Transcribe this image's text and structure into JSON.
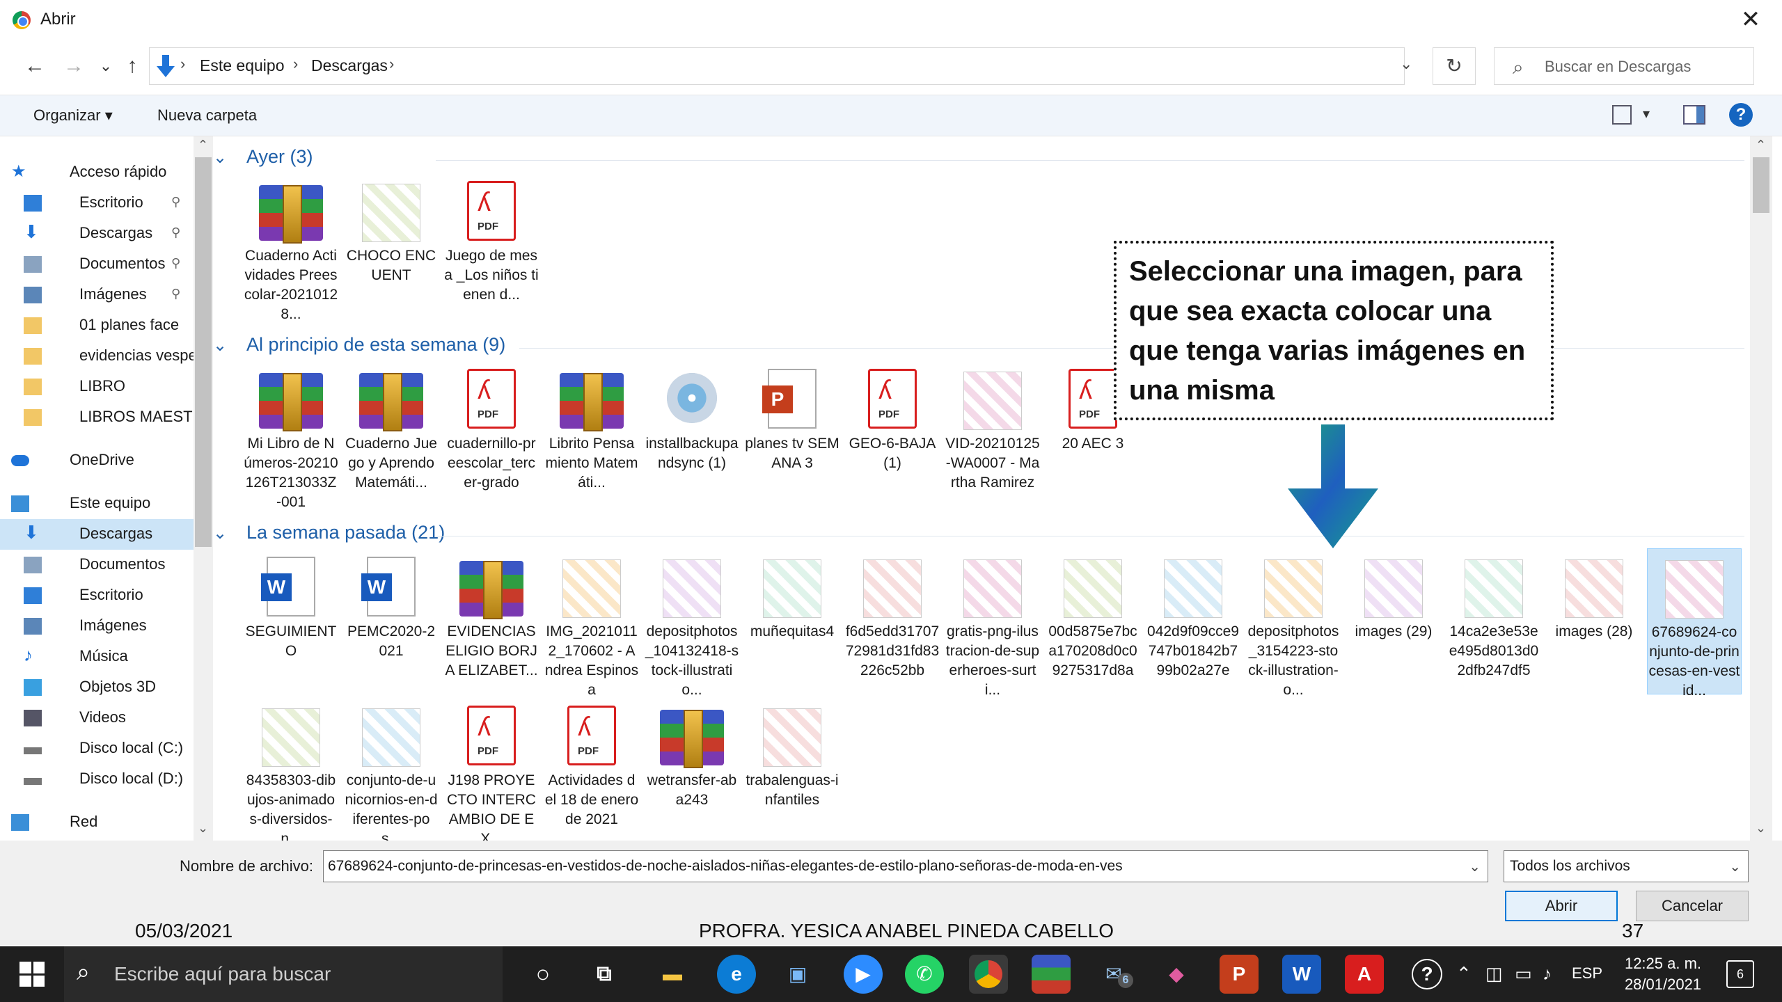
{
  "window": {
    "title": "Abrir",
    "close": "✕"
  },
  "nav": {
    "back": "←",
    "forward": "→",
    "recent": "⌄",
    "up": "↑",
    "breadcrumb": [
      "Este equipo",
      "Descargas"
    ],
    "sep": "›",
    "refresh": "↻",
    "search_placeholder": "Buscar en Descargas"
  },
  "toolbar": {
    "organize": "Organizar ▾",
    "new_folder": "Nueva carpeta",
    "help": "?"
  },
  "sidebar": {
    "items": [
      {
        "label": "Acceso rápido",
        "indent": 0,
        "icon": "star-icon",
        "pin": false
      },
      {
        "label": "Escritorio",
        "indent": 1,
        "icon": "desktop-icon",
        "pin": true
      },
      {
        "label": "Descargas",
        "indent": 1,
        "icon": "download-icon",
        "pin": true
      },
      {
        "label": "Documentos",
        "indent": 1,
        "icon": "documents-icon",
        "pin": true
      },
      {
        "label": "Imágenes",
        "indent": 1,
        "icon": "pictures-icon",
        "pin": true
      },
      {
        "label": "01 planes face",
        "indent": 1,
        "icon": "folder-icon",
        "pin": false
      },
      {
        "label": "evidencias vespe",
        "indent": 1,
        "icon": "folder-icon",
        "pin": false
      },
      {
        "label": "LIBRO",
        "indent": 1,
        "icon": "folder-icon",
        "pin": false
      },
      {
        "label": "LIBROS MAESTR",
        "indent": 1,
        "icon": "folder-icon",
        "pin": false
      },
      {
        "label": "OneDrive",
        "indent": 0,
        "icon": "onedrive-icon",
        "pin": false
      },
      {
        "label": "Este equipo",
        "indent": 0,
        "icon": "computer-icon",
        "pin": false
      },
      {
        "label": "Descargas",
        "indent": 1,
        "icon": "download-icon",
        "pin": false,
        "selected": true
      },
      {
        "label": "Documentos",
        "indent": 1,
        "icon": "documents-icon",
        "pin": false
      },
      {
        "label": "Escritorio",
        "indent": 1,
        "icon": "desktop-icon",
        "pin": false
      },
      {
        "label": "Imágenes",
        "indent": 1,
        "icon": "pictures-icon",
        "pin": false
      },
      {
        "label": "Música",
        "indent": 1,
        "icon": "music-icon",
        "pin": false
      },
      {
        "label": "Objetos 3D",
        "indent": 1,
        "icon": "objects3d-icon",
        "pin": false
      },
      {
        "label": "Videos",
        "indent": 1,
        "icon": "videos-icon",
        "pin": false
      },
      {
        "label": "Disco local (C:)",
        "indent": 1,
        "icon": "drive-icon",
        "pin": false
      },
      {
        "label": "Disco local (D:)",
        "indent": 1,
        "icon": "drive-icon",
        "pin": false
      },
      {
        "label": "Red",
        "indent": 0,
        "icon": "network-icon",
        "pin": false
      }
    ]
  },
  "groups": [
    {
      "header": "Ayer (3)",
      "files": [
        {
          "type": "rar",
          "name": "Cuaderno Actividades Preescolar-20210128..."
        },
        {
          "type": "img",
          "name": "CHOCO ENCUENT"
        },
        {
          "type": "pdf",
          "name": "Juego de mesa _Los niños tienen d..."
        }
      ]
    },
    {
      "header": "Al principio de esta semana (9)",
      "files": [
        {
          "type": "rar",
          "name": "Mi Libro de Números-20210126T213033Z-001"
        },
        {
          "type": "rar",
          "name": "Cuaderno Juego y Aprendo Matemáti..."
        },
        {
          "type": "pdf",
          "name": "cuadernillo-preescolar_tercer-grado"
        },
        {
          "type": "rar",
          "name": "Librito Pensamiento Matemáti..."
        },
        {
          "type": "disc",
          "name": "installbackupandsync (1)"
        },
        {
          "type": "ppt",
          "name": "planes tv SEMANA 3"
        },
        {
          "type": "pdf",
          "name": "GEO-6-BAJA (1)"
        },
        {
          "type": "img",
          "name": "VID-20210125-WA0007 - Martha Ramirez"
        },
        {
          "type": "pdf",
          "name": "20 AEC 3"
        }
      ]
    },
    {
      "header": "La semana pasada (21)",
      "files": [
        {
          "type": "word",
          "name": "SEGUIMIENTO"
        },
        {
          "type": "word",
          "name": "PEMC2020-2021"
        },
        {
          "type": "rar",
          "name": "EVIDENCIAS ELIGIO BORJA ELIZABET..."
        },
        {
          "type": "img",
          "name": "IMG_20210112_170602 - Andrea Espinosa"
        },
        {
          "type": "img",
          "name": "depositphotos_104132418-stock-illustratio..."
        },
        {
          "type": "img",
          "name": "muñequitas4"
        },
        {
          "type": "img",
          "name": "f6d5edd3170772981d31fd83226c52bb"
        },
        {
          "type": "img",
          "name": "gratis-png-ilustracion-de-superheroes-surti..."
        },
        {
          "type": "img",
          "name": "00d5875e7bca170208d0c09275317d8a"
        },
        {
          "type": "img",
          "name": "042d9f09cce9747b01842b799b02a27e"
        },
        {
          "type": "img",
          "name": "depositphotos_3154223-stock-illustration-o..."
        },
        {
          "type": "img",
          "name": "images (29)"
        },
        {
          "type": "img",
          "name": "14ca2e3e53ee495d8013d02dfb247df5"
        },
        {
          "type": "img",
          "name": "images (28)"
        },
        {
          "type": "img",
          "name": "67689624-conjunto-de-princesas-en-vestid...",
          "selected": true
        },
        {
          "type": "img",
          "name": "84358303-dibujos-animados-diversidos-n..."
        },
        {
          "type": "img",
          "name": "conjunto-de-unicornios-en-diferentes-pos..."
        },
        {
          "type": "pdf",
          "name": "J198 PROYECTO INTERCAMBIO DE EX..."
        },
        {
          "type": "pdf",
          "name": "Actividades del 18 de enero de 2021"
        },
        {
          "type": "rar",
          "name": "wetransfer-aba243"
        },
        {
          "type": "img",
          "name": "trabalenguas-infantiles"
        }
      ]
    }
  ],
  "callout": "Seleccionar una imagen, para que sea exacta colocar una que tenga varias imágenes en una misma",
  "bottom": {
    "filename_label": "Nombre de archivo:",
    "filename_value": "67689624-conjunto-de-princesas-en-vestidos-de-noche-aislados-niñas-elegantes-de-estilo-plano-señoras-de-moda-en-ves",
    "filetype": "Todos los archivos",
    "open": "Abrir",
    "cancel": "Cancelar"
  },
  "slide_footer": {
    "date": "05/03/2021",
    "author": "PROFRA. YESICA ANABEL PINEDA CABELLO",
    "page": "37"
  },
  "taskbar": {
    "search_placeholder": "Escribe aquí para buscar",
    "lang": "ESP",
    "time": "12:25 a. m.",
    "date": "28/01/2021",
    "notifications": "6",
    "mail_badge": "6"
  },
  "colors": {
    "accent": "#0078d7",
    "group_header": "#1e5fa8",
    "selected": "#cce4f7",
    "taskbar": "#1f1f1f"
  }
}
